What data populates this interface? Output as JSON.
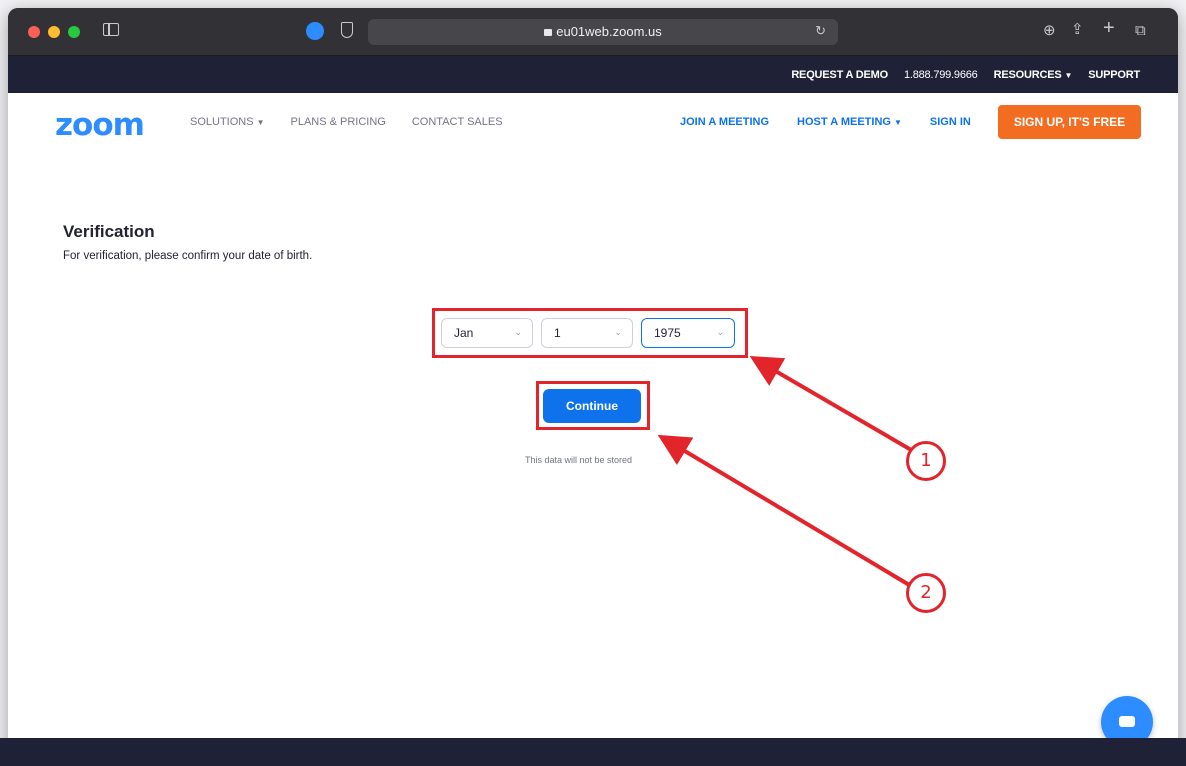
{
  "browser": {
    "url": "eu01web.zoom.us",
    "icons": [
      "sidebar-icon",
      "extension-icon",
      "shield-icon",
      "lock-icon",
      "reload-icon",
      "download-icon",
      "share-icon",
      "plus-icon",
      "tabs-icon"
    ]
  },
  "topbar": {
    "request_demo": "REQUEST A DEMO",
    "phone": "1.888.799.9666",
    "resources": "RESOURCES",
    "support": "SUPPORT"
  },
  "nav": {
    "logo": "zoom",
    "solutions": "SOLUTIONS",
    "plans": "PLANS & PRICING",
    "contact": "CONTACT SALES",
    "join": "JOIN A MEETING",
    "host": "HOST A MEETING",
    "signin": "SIGN IN",
    "signup": "SIGN UP, IT'S FREE"
  },
  "verification": {
    "title": "Verification",
    "subtitle": "For verification, please confirm your date of birth.",
    "month": "Jan",
    "day": "1",
    "year": "1975",
    "continue_label": "Continue",
    "note": "This data will not be stored"
  },
  "annotations": {
    "badge1": "1",
    "badge2": "2",
    "color": "#e3242b"
  },
  "colors": {
    "brand_blue": "#2d8cff",
    "button_blue": "#0e72ed",
    "signup_orange": "#f26d21",
    "topbar_dark": "#1f2236"
  }
}
